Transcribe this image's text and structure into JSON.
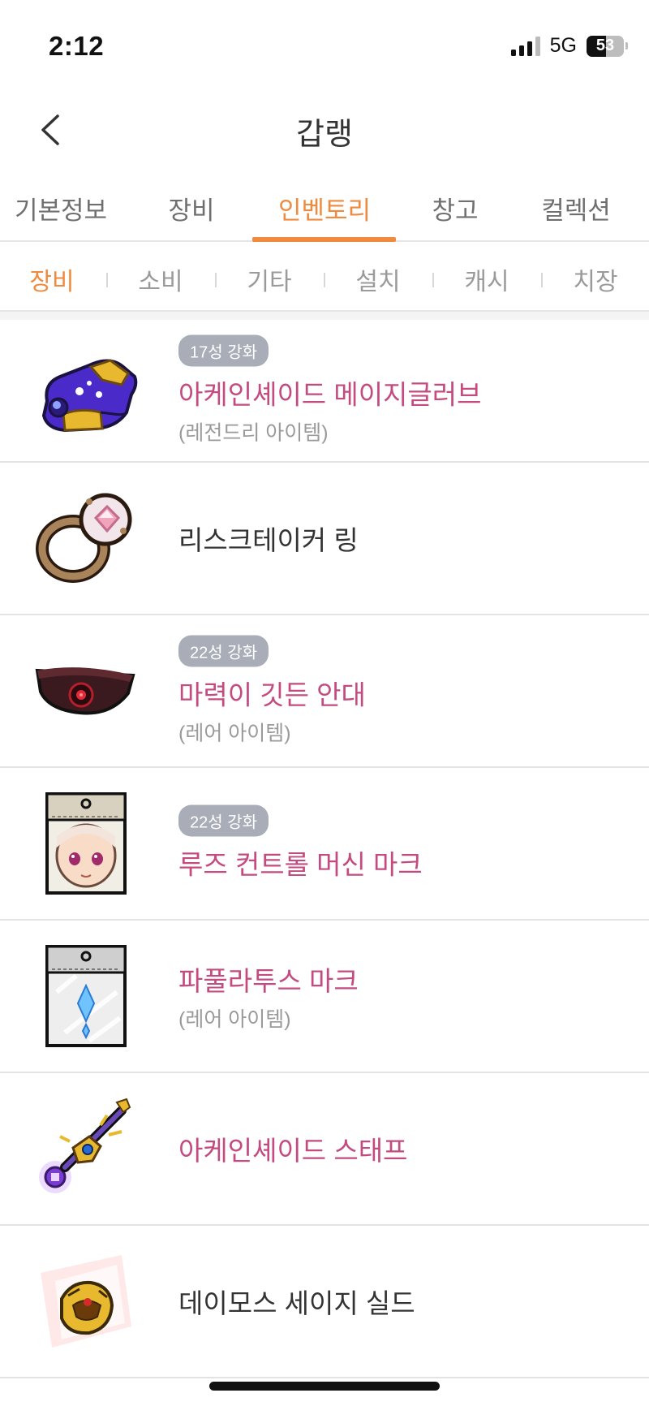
{
  "status_bar": {
    "time": "2:12",
    "network": "5G",
    "battery_level": "53",
    "battery_fraction": 0.53
  },
  "header": {
    "title": "갑랭"
  },
  "main_tabs": [
    {
      "label": "기본정보",
      "active": false
    },
    {
      "label": "장비",
      "active": false
    },
    {
      "label": "인벤토리",
      "active": true
    },
    {
      "label": "창고",
      "active": false
    },
    {
      "label": "컬렉션",
      "active": false
    }
  ],
  "sub_tabs": [
    {
      "label": "장비",
      "active": true
    },
    {
      "label": "소비",
      "active": false
    },
    {
      "label": "기타",
      "active": false
    },
    {
      "label": "설치",
      "active": false
    },
    {
      "label": "캐시",
      "active": false
    },
    {
      "label": "치장",
      "active": false
    }
  ],
  "items": [
    {
      "name": "아케인셰이드 메이지글러브",
      "star": "17성 강화",
      "grade": "(레전드리 아이템)",
      "icon": "glove-icon",
      "highlight": true
    },
    {
      "name": "리스크테이커 링",
      "star": "",
      "grade": "",
      "icon": "ring-icon",
      "highlight": false
    },
    {
      "name": "마력이 깃든 안대",
      "star": "22성 강화",
      "grade": "(레어 아이템)",
      "icon": "eyepatch-icon",
      "highlight": true
    },
    {
      "name": "루즈 컨트롤 머신 마크",
      "star": "22성 강화",
      "grade": "",
      "icon": "face-mark-icon",
      "highlight": true
    },
    {
      "name": "파풀라투스 마크",
      "star": "",
      "grade": "(레어 아이템)",
      "icon": "crystal-mark-icon",
      "highlight": true
    },
    {
      "name": "아케인셰이드 스태프",
      "star": "",
      "grade": "",
      "icon": "staff-icon",
      "highlight": true
    },
    {
      "name": "데이모스 세이지 실드",
      "star": "",
      "grade": "",
      "icon": "shield-icon",
      "highlight": false
    }
  ],
  "colors": {
    "accent": "#ef8a3f",
    "item_name": "#c44b80",
    "badge": "#a9adb8"
  }
}
